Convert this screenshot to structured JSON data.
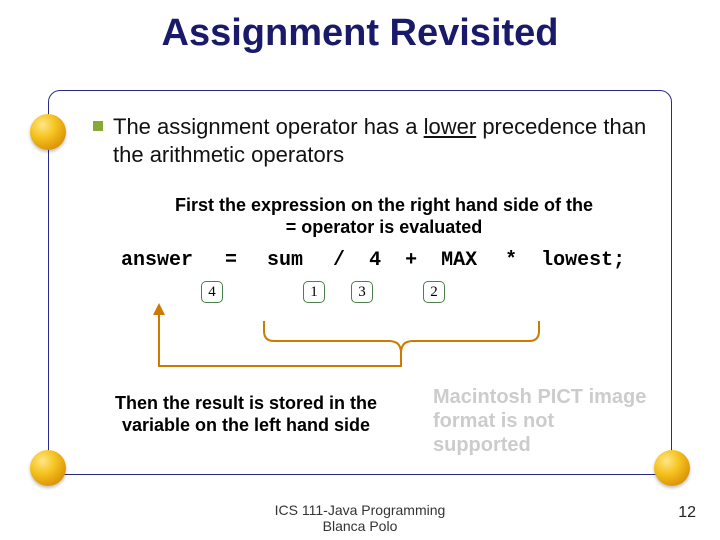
{
  "title": "Assignment Revisited",
  "bullet": {
    "pre": "The assignment operator has a ",
    "underlined": "lower",
    "post": " precedence than the arithmetic operators"
  },
  "caption_top": "First the expression on the right hand side of the = operator is evaluated",
  "code": {
    "answer": "answer",
    "eq": "=",
    "sum": "sum",
    "slash": "/",
    "four": "4",
    "plus": "+",
    "max": "MAX",
    "star": "*",
    "lowest": "lowest;"
  },
  "steps": {
    "s1": "1",
    "s2": "2",
    "s3": "3",
    "s4": "4"
  },
  "caption_bottom": "Then the result is stored in the variable on the left hand side",
  "pict_error": "Macintosh PICT image format is not supported",
  "footer": {
    "line1": "ICS 111-Java Programming",
    "line2": "Blanca Polo"
  },
  "page_number": "12"
}
